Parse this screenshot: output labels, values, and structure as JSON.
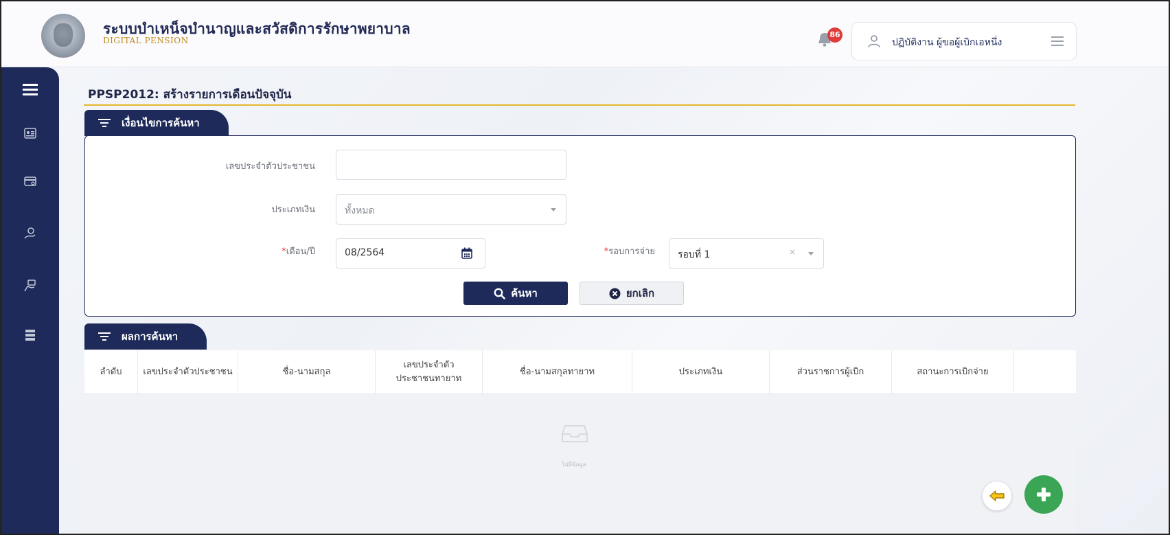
{
  "header": {
    "app_title": "ระบบบำเหน็จบำนาญและสวัสดิการรักษาพยาบาล",
    "app_subtitle": "DIGITAL PENSION",
    "notification_count": "86",
    "user_label": "ปฏิบัติงาน ผู้ขอผู้เบิกเอหนึ่ง"
  },
  "page": {
    "title": "PPSP2012: สร้างรายการเดือนปัจจุบัน"
  },
  "search_section": {
    "tab_label": "เงื่อนไขการค้นหา",
    "fields": {
      "citizen_id": {
        "label": "เลขประจำตัวประชาชน",
        "value": ""
      },
      "money_type": {
        "label": "ประเภทเงิน",
        "value": "ทั้งหมด"
      },
      "month_year": {
        "required_mark": "*",
        "label": "เดือน/ปี",
        "value": "08/2564"
      },
      "payment_round": {
        "required_mark": "*",
        "label": "รอบการจ่าย",
        "value": "รอบที่ 1",
        "clear": "×"
      }
    },
    "search_button": "ค้นหา",
    "cancel_button": "ยกเลิก"
  },
  "results_section": {
    "tab_label": "ผลการค้นหา",
    "columns": [
      "ลำดับ",
      "เลขประจำตัวประชาชน",
      "ชื่อ-นามสกุล",
      "เลขประจำตัว\nประชาชนทายาท",
      "ชื่อ-นามสกุลทายาท",
      "ประเภทเงิน",
      "ส่วนราชการผู้เบิก",
      "สถานะการเบิกจ่าย"
    ],
    "empty_text": "ไม่มีข้อมูล"
  },
  "colors": {
    "navy": "#1d2a5a",
    "gold": "#e5b72c",
    "badge_red": "#e03b3b",
    "fab_green": "#3aa655"
  }
}
